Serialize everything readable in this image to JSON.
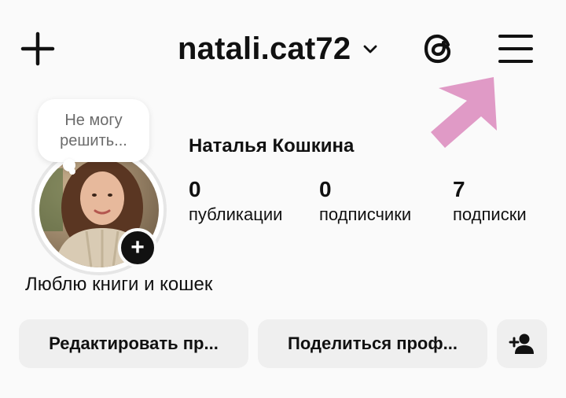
{
  "header": {
    "username": "natali.cat72"
  },
  "note": {
    "line1": "Не могу",
    "line2": "решить..."
  },
  "profile": {
    "full_name": "Наталья Кошкина",
    "bio": "Люблю книги и кошек",
    "stats": [
      {
        "value": "0",
        "label": "публикации"
      },
      {
        "value": "0",
        "label": "подписчики"
      },
      {
        "value": "7",
        "label": "подписки"
      }
    ]
  },
  "actions": {
    "edit_label": "Редактировать пр...",
    "share_label": "Поделиться проф..."
  },
  "icons": {
    "create": "plus-icon",
    "switch_account": "chevron-down-icon",
    "threads": "threads-icon",
    "menu": "hamburger-menu-icon",
    "add_story": "plus-icon",
    "discover_people": "add-person-icon"
  },
  "colors": {
    "background": "#fafafa",
    "button_bg": "#efefef",
    "annotation_arrow": "#e09ac6"
  }
}
